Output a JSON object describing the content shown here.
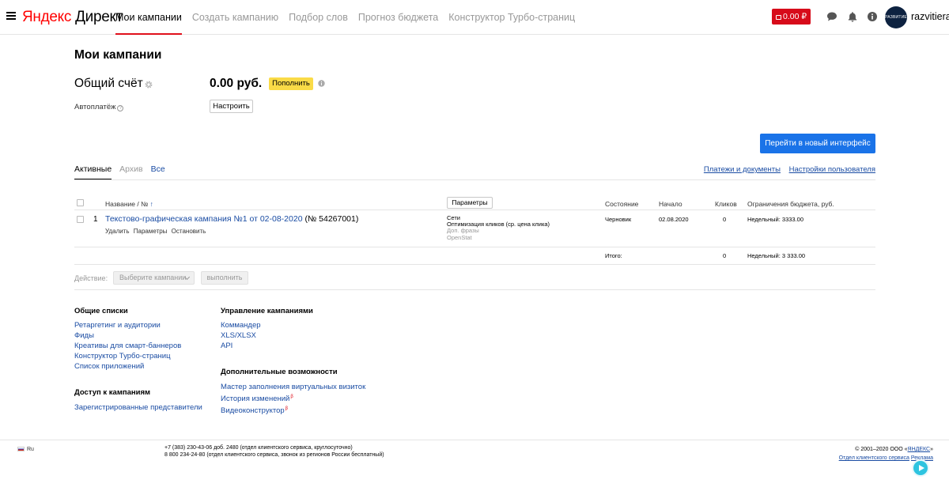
{
  "header": {
    "logo_brand": "Яндекс",
    "logo_product": "Директ",
    "nav": [
      {
        "label": "Мои кампании",
        "active": true
      },
      {
        "label": "Создать кампанию"
      },
      {
        "label": "Подбор слов"
      },
      {
        "label": "Прогноз бюджета"
      },
      {
        "label": "Конструктор Турбо-страниц"
      }
    ],
    "balance": "0.00 ₽",
    "avatar_text": "РАЗВИТИЕ",
    "username": "razvitiera",
    "icons": [
      "menu-icon",
      "chat-icon",
      "bell-icon",
      "info-icon",
      "wallet-icon"
    ]
  },
  "page": {
    "title": "Мои кампании",
    "account_title": "Общий счёт",
    "amount": "0.00 руб.",
    "topup_label": "Пополнить",
    "autopay_label": "Автоплатёж",
    "autopay_help": "?",
    "setup_label": "Настроить",
    "new_ui_label": "Перейти в новый интерфейс"
  },
  "tabs": [
    {
      "label": "Активные",
      "active": true
    },
    {
      "label": "Архив"
    },
    {
      "label": "Все"
    }
  ],
  "top_links": {
    "payments": "Платежи и документы",
    "user_settings": "Настройки пользователя"
  },
  "table": {
    "headers": {
      "name": "Название / №",
      "sort_arrow": "↑",
      "params_button": "Параметры",
      "state": "Состояние",
      "start": "Начало",
      "clicks": "Кликов",
      "budget": "Ограничения бюджета, руб."
    },
    "rows": [
      {
        "num": "1",
        "name": "Текстово-графическая кампания №1 от 02-08-2020",
        "id": "(№ 54267001)",
        "actions": [
          "Удалить",
          "Параметры",
          "Остановить"
        ],
        "strategy": [
          "Сети",
          "Оптимизация кликов (ср. цена клика)"
        ],
        "strategy_extra": [
          "Доп. фразы",
          "OpenStat"
        ],
        "state": "Черновик",
        "start": "02.08.2020",
        "clicks": "0",
        "budget": "Недельный: 3333.00"
      }
    ],
    "totals": {
      "label": "Итого:",
      "clicks": "0",
      "budget": "Недельный: 3 333.00"
    }
  },
  "action_bar": {
    "label": "Действие:",
    "select_placeholder": "Выберите кампании",
    "execute": "выполнить"
  },
  "lists": {
    "common": {
      "title": "Общие списки",
      "items": [
        "Ретаргетинг и аудитории",
        "Фиды",
        "Креативы для смарт-баннеров",
        "Конструктор Турбо-страниц",
        "Список приложений"
      ]
    },
    "access": {
      "title": "Доступ к кампаниям",
      "items": [
        "Зарегистрированные представители"
      ]
    },
    "management": {
      "title": "Управление кампаниями",
      "items": [
        "Коммандер",
        "XLS/XLSX",
        "API"
      ]
    },
    "extra": {
      "title": "Дополнительные возможности",
      "items": [
        "Мастер заполнения виртуальных визиток",
        "История изменений",
        "Видеоконструктор"
      ],
      "beta_mark": "β"
    }
  },
  "footer": {
    "lang": "Ru",
    "phone1": "+7 (383) 230-43-06 доб. 2480 (отдел клиентского сервиса, круглосуточно)",
    "phone2": "8 800 234-24-80 (отдел клиентского сервиса, звонок из регионов России бесплатный)",
    "copyright_prefix": "© 2001–2020 ООО «",
    "copyright_link": "ЯНДЕКС",
    "copyright_suffix": "»",
    "support_link": "Отдел клиентского сервиса",
    "ad_link": "Реклама"
  },
  "colors": {
    "accent_red": "#d70b1a",
    "button_yellow": "#fadb47",
    "primary_blue": "#1a73e8",
    "link_blue": "#1a4ca3"
  }
}
